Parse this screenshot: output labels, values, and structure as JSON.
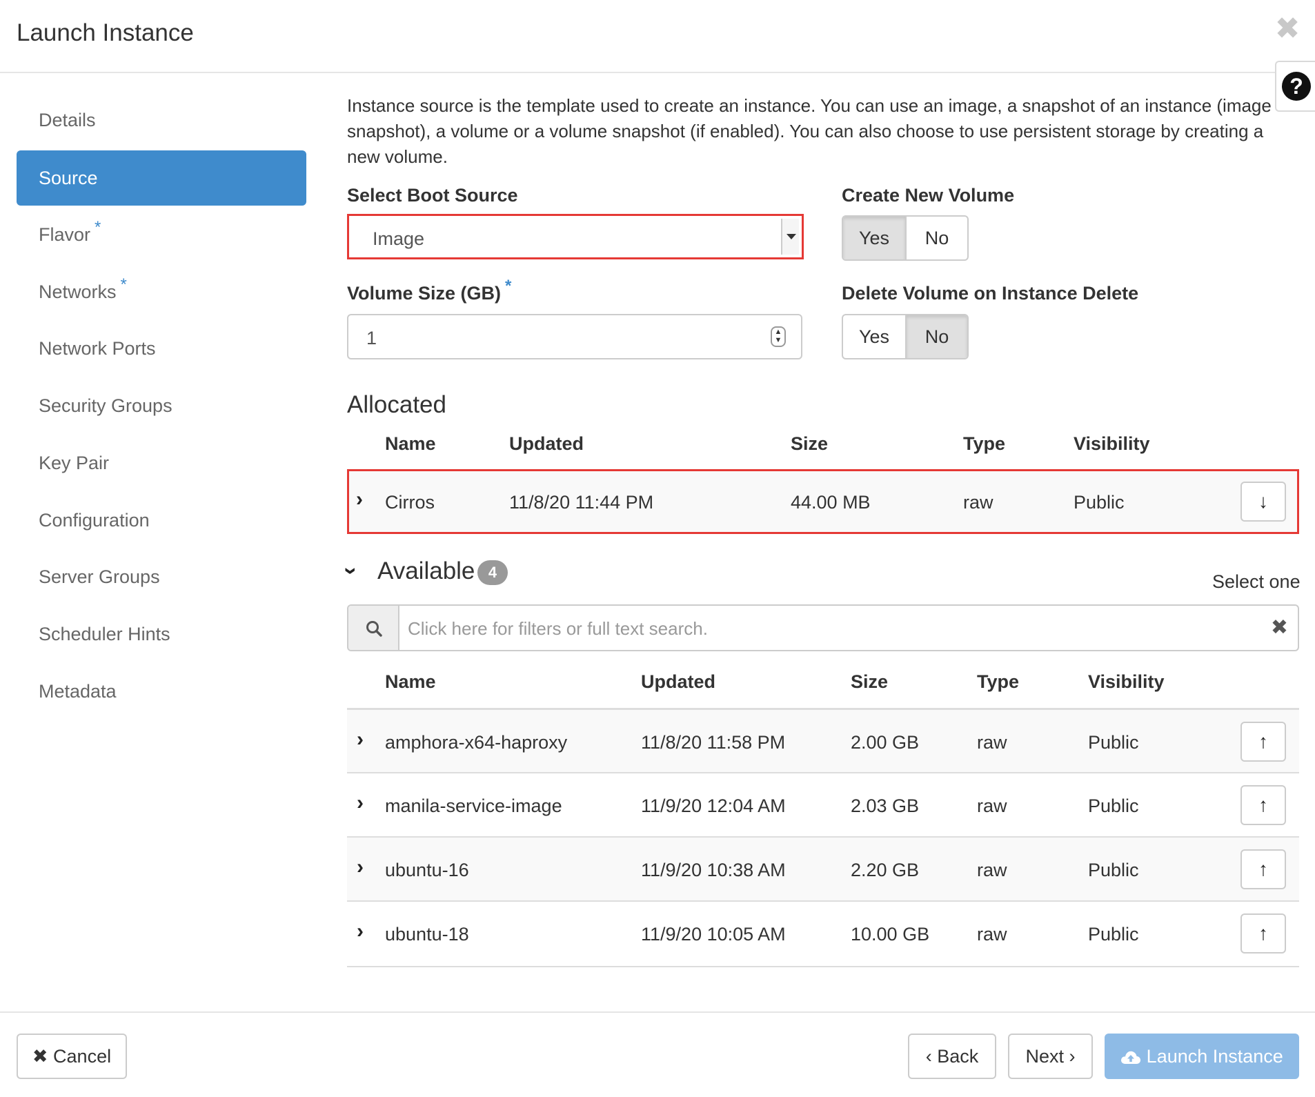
{
  "dialog": {
    "title": "Launch Instance",
    "close_glyph": "✖",
    "help_glyph": "?"
  },
  "sidebar": {
    "items": [
      {
        "label": "Details",
        "required": false
      },
      {
        "label": "Source",
        "required": false,
        "active": true
      },
      {
        "label": "Flavor",
        "required": true
      },
      {
        "label": "Networks",
        "required": true
      },
      {
        "label": "Network Ports",
        "required": false
      },
      {
        "label": "Security Groups",
        "required": false
      },
      {
        "label": "Key Pair",
        "required": false
      },
      {
        "label": "Configuration",
        "required": false
      },
      {
        "label": "Server Groups",
        "required": false
      },
      {
        "label": "Scheduler Hints",
        "required": false
      },
      {
        "label": "Metadata",
        "required": false
      }
    ],
    "required_mark": "*"
  },
  "source": {
    "intro": "Instance source is the template used to create an instance. You can use an image, a snapshot of an instance (image snapshot), a volume or a volume snapshot (if enabled). You can also choose to use persistent storage by creating a new volume.",
    "boot_source_label": "Select Boot Source",
    "boot_source_value": "Image",
    "create_volume_label": "Create New Volume",
    "create_volume_yes": "Yes",
    "create_volume_no": "No",
    "volume_size_label": "Volume Size (GB)",
    "volume_size_value": "1",
    "delete_volume_label": "Delete Volume on Instance Delete",
    "delete_volume_yes": "Yes",
    "delete_volume_no": "No"
  },
  "allocated": {
    "title": "Allocated",
    "columns": [
      "Name",
      "Updated",
      "Size",
      "Type",
      "Visibility"
    ],
    "rows": [
      {
        "name": "Cirros",
        "updated": "11/8/20 11:44 PM",
        "size": "44.00 MB",
        "type": "raw",
        "visibility": "Public"
      }
    ]
  },
  "available": {
    "title": "Available",
    "count": "4",
    "select_hint": "Select one",
    "search_placeholder": "Click here for filters or full text search.",
    "columns": [
      "Name",
      "Updated",
      "Size",
      "Type",
      "Visibility"
    ],
    "rows": [
      {
        "name": "amphora-x64-haproxy",
        "updated": "11/8/20 11:58 PM",
        "size": "2.00 GB",
        "type": "raw",
        "visibility": "Public"
      },
      {
        "name": "manila-service-image",
        "updated": "11/9/20 12:04 AM",
        "size": "2.03 GB",
        "type": "raw",
        "visibility": "Public"
      },
      {
        "name": "ubuntu-16",
        "updated": "11/9/20 10:38 AM",
        "size": "2.20 GB",
        "type": "raw",
        "visibility": "Public"
      },
      {
        "name": "ubuntu-18",
        "updated": "11/9/20 10:05 AM",
        "size": "10.00 GB",
        "type": "raw",
        "visibility": "Public"
      }
    ]
  },
  "footer": {
    "cancel_label": "Cancel",
    "back_label": "Back",
    "next_label": "Next",
    "launch_label": "Launch Instance"
  },
  "colors": {
    "accent": "#3f8bcc",
    "highlight_border": "#e53935",
    "primary_disabled": "#8ebbe6"
  }
}
